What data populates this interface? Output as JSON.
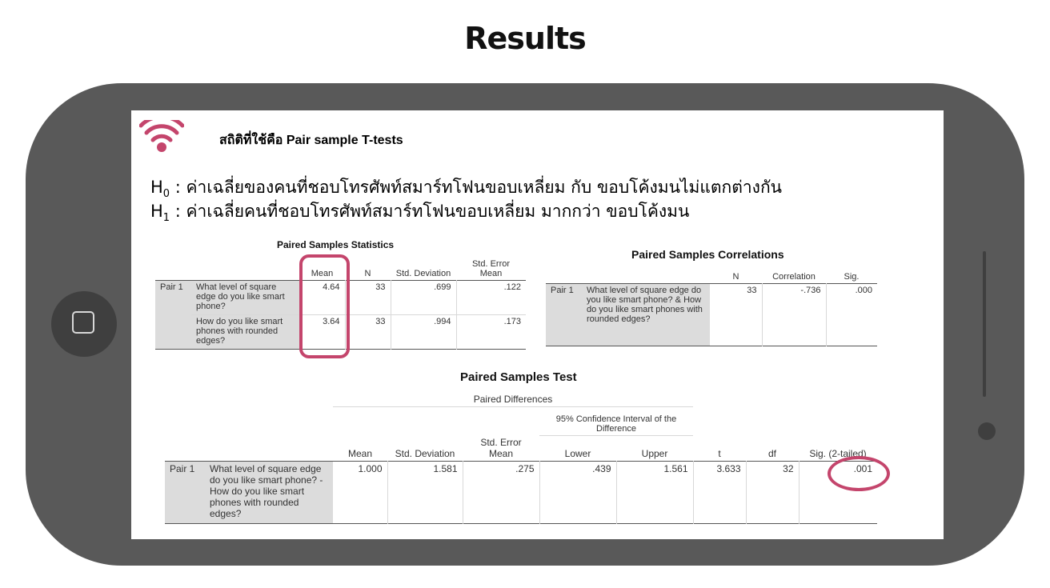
{
  "page_title": "Results",
  "accent_color": "#c4456c",
  "screen": {
    "icon": "wifi-icon",
    "stat_label": "สถิติที่ใช้คือ Pair sample T-tests",
    "h0": {
      "symbol": "H",
      "sub": "0",
      "text": " : ค่าเฉลี่ยของคนที่ชอบโทรศัพท์สมาร์ทโฟนขอบเหลี่ยม กับ ขอบโค้งมนไม่แตกต่างกัน"
    },
    "h1": {
      "symbol": "H",
      "sub": "1",
      "text": " : ค่าเฉลี่ยคนที่ชอบโทรศัพท์สมาร์ทโฟนขอบเหลี่ยม มากกว่า ขอบโค้งมน"
    }
  },
  "stats_table": {
    "title": "Paired Samples Statistics",
    "headers": {
      "mean": "Mean",
      "n": "N",
      "sd": "Std. Deviation",
      "sem": "Std. Error Mean"
    },
    "pair": "Pair 1",
    "rows": [
      {
        "label": "What level of square edge do you like smart phone?",
        "mean": "4.64",
        "n": "33",
        "sd": ".699",
        "sem": ".122"
      },
      {
        "label": "How do you like smart phones with rounded edges?",
        "mean": "3.64",
        "n": "33",
        "sd": ".994",
        "sem": ".173"
      }
    ]
  },
  "corr_table": {
    "title": "Paired Samples Correlations",
    "headers": {
      "n": "N",
      "corr": "Correlation",
      "sig": "Sig."
    },
    "pair": "Pair 1",
    "row": {
      "label": "What level of square edge do you like smart phone? & How do you like smart phones with rounded edges?",
      "n": "33",
      "corr": "-.736",
      "sig": ".000"
    }
  },
  "test_table": {
    "title": "Paired Samples Test",
    "headers": {
      "paired_diff": "Paired Differences",
      "ci": "95% Confidence Interval of the Difference",
      "mean": "Mean",
      "sd": "Std. Deviation",
      "sem": "Std. Error Mean",
      "lower": "Lower",
      "upper": "Upper",
      "t": "t",
      "df": "df",
      "sig": "Sig. (2-tailed)"
    },
    "pair": "Pair 1",
    "row": {
      "label": "What level of square edge do you like smart phone? - How do you like smart phones with rounded edges?",
      "mean": "1.000",
      "sd": "1.581",
      "sem": ".275",
      "lower": ".439",
      "upper": "1.561",
      "t": "3.633",
      "df": "32",
      "sig": ".001"
    }
  }
}
